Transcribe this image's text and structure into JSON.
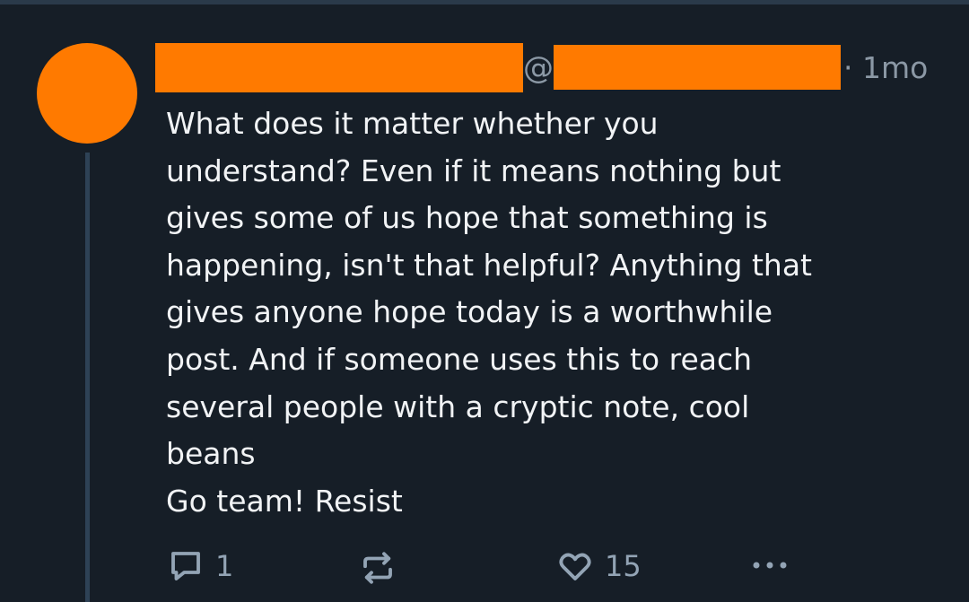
{
  "post": {
    "at_symbol": "@",
    "time": "· 1mo",
    "text_lines": [
      "What does it matter whether you",
      "understand? Even if it means nothing but",
      "gives some of us hope that something is",
      "happening, isn't that helpful? Anything that",
      "gives anyone hope today is a worthwhile",
      "post. And if someone uses this to reach",
      "several people with a cryptic note, cool",
      "beans",
      "Go team! Resist"
    ]
  },
  "actions": {
    "reply_count": "1",
    "like_count": "15",
    "reply_icon": "reply-icon",
    "repost_icon": "repost-icon",
    "like_icon": "heart-icon",
    "more_icon": "more-icon"
  },
  "colors": {
    "background": "#161e27",
    "redaction": "#ff7a00",
    "muted_text": "#8b98a5",
    "thread_line": "#2e4256"
  }
}
